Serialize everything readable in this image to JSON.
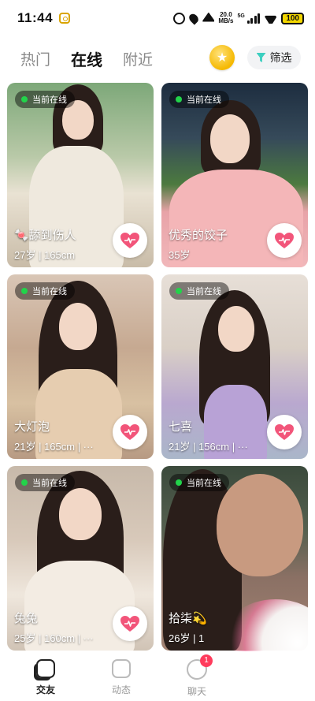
{
  "status_bar": {
    "time": "11:44",
    "net_speed_value": "20.0",
    "net_speed_unit": "MB/s",
    "network": "5G",
    "battery": "100"
  },
  "tabs": [
    {
      "label": "热门",
      "active": false
    },
    {
      "label": "在线",
      "active": true
    },
    {
      "label": "附近",
      "active": false
    }
  ],
  "filter_label": "筛选",
  "online_badge": "当前在线",
  "cards": [
    {
      "name": "🍬舔到伤人",
      "info": "27岁 | 165cm"
    },
    {
      "name": "优秀的饺子",
      "info": "35岁"
    },
    {
      "name": "大灯泡",
      "info": "21岁 | 165cm | ···"
    },
    {
      "name": "七喜",
      "info": "21岁 | 156cm | ···"
    },
    {
      "name": "兔兔",
      "info": "25岁 | 160cm | ···"
    },
    {
      "name": "拾柒💫",
      "info": "26岁 | 1"
    }
  ],
  "bottom_nav": [
    {
      "label": "交友",
      "active": true
    },
    {
      "label": "动态",
      "active": false
    },
    {
      "label": "聊天",
      "active": false,
      "badge": "1"
    }
  ],
  "colors": {
    "online_dot": "#22d34a",
    "like_heart": "#f2557a",
    "filter_icon": "#3ccfc0",
    "coin": "#f5b800",
    "badge": "#ff3b5c"
  }
}
